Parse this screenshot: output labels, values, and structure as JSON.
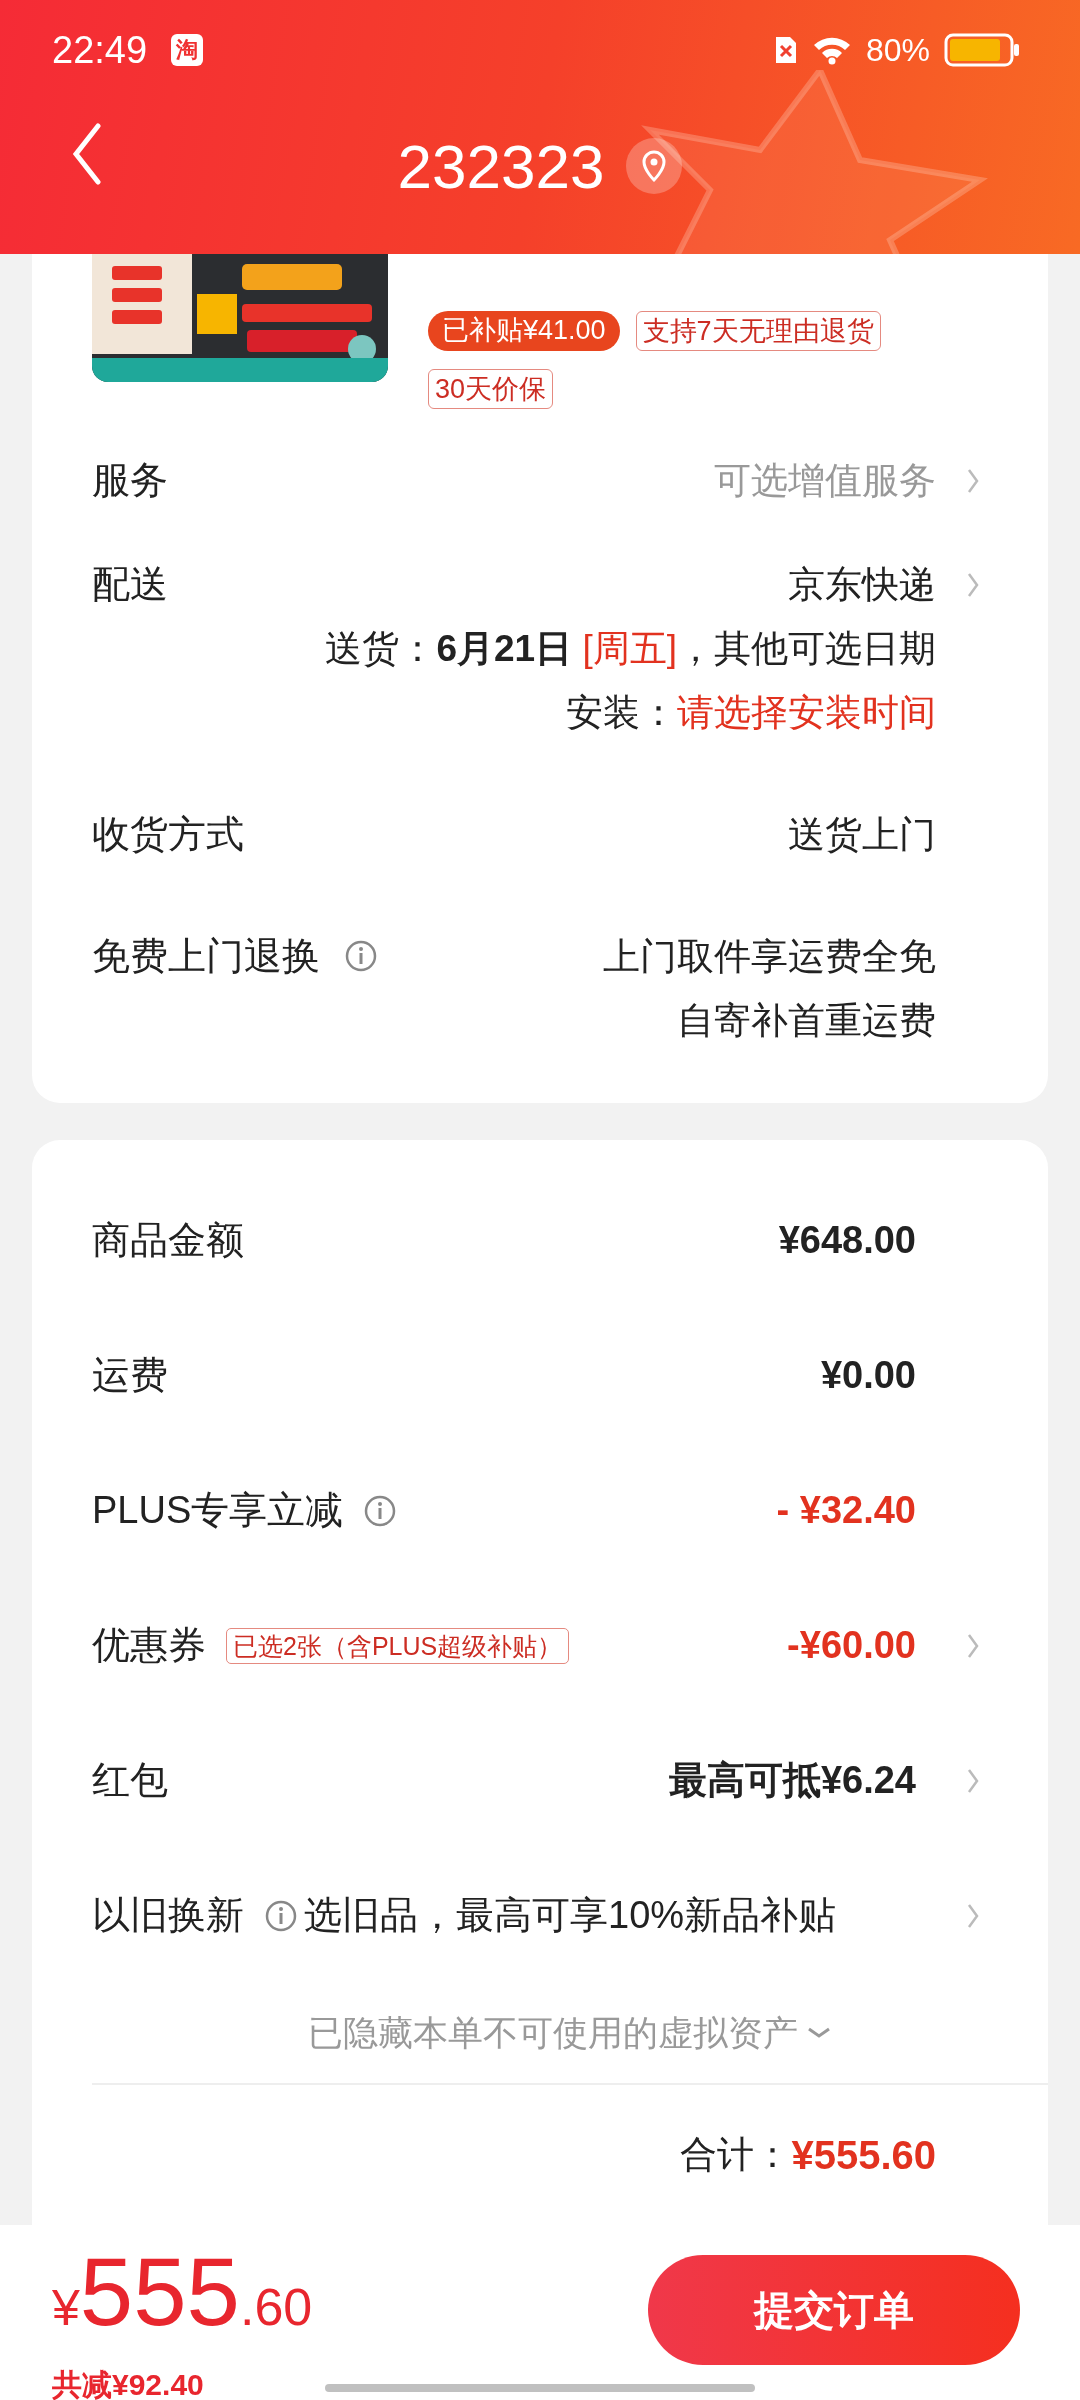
{
  "status_bar": {
    "time": "22:49",
    "app_badge": "淘",
    "battery": "80%"
  },
  "header": {
    "title": "232323"
  },
  "product": {
    "kind": "picture",
    "tags": [
      {
        "text": "已补贴¥41.00",
        "kind": "filled"
      },
      {
        "text": "支持7天无理由退货",
        "kind": "outline"
      },
      {
        "text": "30天价保",
        "kind": "outline"
      }
    ]
  },
  "services": [
    {
      "label": "服务",
      "info": false,
      "values": [
        {
          "segments": [
            {
              "text": "可选增值服务",
              "kind": "muted"
            }
          ]
        }
      ],
      "chevron": true
    },
    {
      "label": "配送",
      "info": false,
      "values": [
        {
          "segments": [
            {
              "text": "京东快递",
              "kind": "plain"
            }
          ]
        },
        {
          "segments": [
            {
              "text": "送货：",
              "kind": "plain"
            },
            {
              "text": "6月21日",
              "kind": "bold"
            },
            {
              "text": " [周五]",
              "kind": "red"
            },
            {
              "text": "，其他可选日期",
              "kind": "plain"
            }
          ]
        },
        {
          "segments": [
            {
              "text": "安装：",
              "kind": "plain"
            },
            {
              "text": "请选择安装时间",
              "kind": "red"
            }
          ]
        }
      ],
      "chevron": true
    },
    {
      "label": "收货方式",
      "info": false,
      "values": [
        {
          "segments": [
            {
              "text": "送货上门",
              "kind": "plain"
            }
          ]
        }
      ],
      "chevron": false
    },
    {
      "label": "免费上门退换",
      "info": true,
      "values": [
        {
          "segments": [
            {
              "text": "上门取件享运费全免",
              "kind": "plain"
            }
          ]
        },
        {
          "segments": [
            {
              "text": "自寄补首重运费",
              "kind": "plain"
            }
          ]
        }
      ],
      "chevron": false
    }
  ],
  "summary": {
    "rows": [
      {
        "label": "商品金额",
        "info": false,
        "value": "¥648.00",
        "kind": "amount",
        "chevron": false
      },
      {
        "label": "运费",
        "info": false,
        "value": "¥0.00",
        "kind": "amount",
        "chevron": false
      },
      {
        "label": "PLUS专享立减",
        "info": true,
        "value": "- ¥32.40",
        "kind": "discount",
        "chevron": false
      },
      {
        "label": "优惠券",
        "info": false,
        "tag": "已选2张（含PLUS超级补贴）",
        "value": "-¥60.00",
        "kind": "discount",
        "chevron": true
      },
      {
        "label": "红包",
        "info": false,
        "value": "最高可抵¥6.24",
        "kind": "amount",
        "chevron": true
      },
      {
        "label": "以旧换新",
        "info": true,
        "value": "选旧品，最高可享10%新品补贴",
        "kind": "inline",
        "chevron": true
      }
    ],
    "hidden_note": "已隐藏本单不可使用的虚拟资产",
    "total_label": "合计：",
    "total": "¥555.60"
  },
  "bottom_bar": {
    "currency": "¥",
    "amount": "555",
    "decimals": ".60",
    "saved": "共减¥92.40",
    "submit": "提交订单"
  }
}
